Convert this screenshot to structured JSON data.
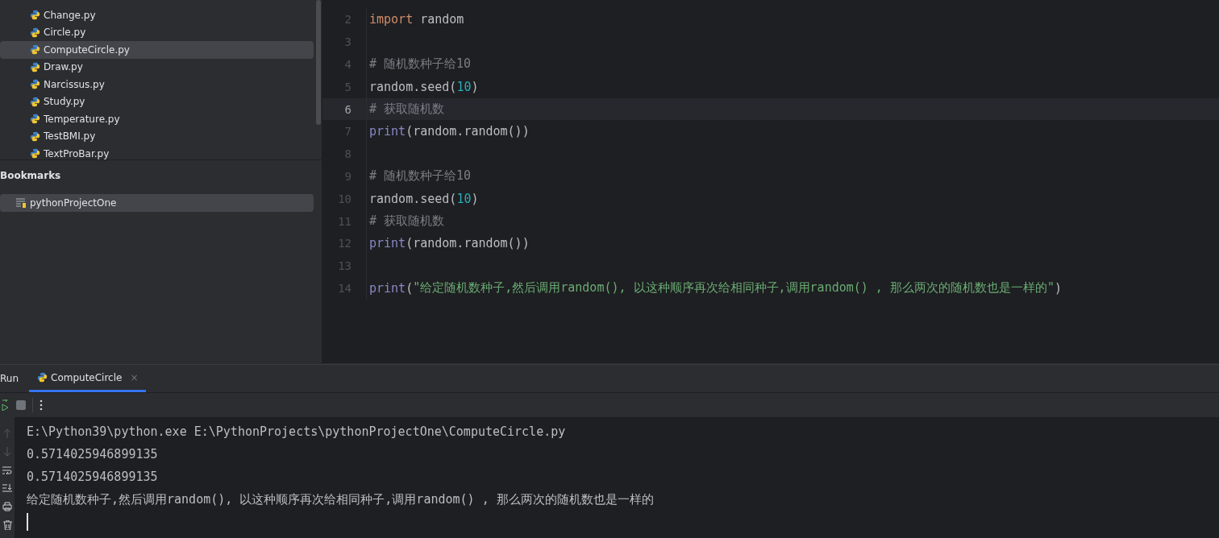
{
  "project_tree": {
    "files": [
      {
        "name": "Change.py",
        "selected": false
      },
      {
        "name": "Circle.py",
        "selected": false
      },
      {
        "name": "ComputeCircle.py",
        "selected": true
      },
      {
        "name": "Draw.py",
        "selected": false
      },
      {
        "name": "Narcissus.py",
        "selected": false
      },
      {
        "name": "Study.py",
        "selected": false
      },
      {
        "name": "Temperature.py",
        "selected": false
      },
      {
        "name": "TestBMI.py",
        "selected": false
      },
      {
        "name": "TextProBar.py",
        "selected": false
      }
    ]
  },
  "bookmarks": {
    "title": "Bookmarks",
    "items": [
      {
        "name": "pythonProjectOne",
        "selected": true
      }
    ]
  },
  "editor": {
    "lines": [
      {
        "number": "2",
        "current": false,
        "tokens": [
          {
            "kind": "keyword",
            "text": "import"
          },
          {
            "kind": "plain",
            "text": " random"
          }
        ]
      },
      {
        "number": "3",
        "current": false
      },
      {
        "number": "4",
        "current": false,
        "tokens": [
          {
            "kind": "comment",
            "text": "# 随机数种子给10"
          }
        ]
      },
      {
        "number": "5",
        "current": false,
        "tokens": [
          {
            "kind": "plain",
            "text": "random.seed("
          },
          {
            "kind": "number",
            "text": "10"
          },
          {
            "kind": "plain",
            "text": ")"
          }
        ]
      },
      {
        "number": "6",
        "current": true,
        "tokens": [
          {
            "kind": "comment",
            "text": "# 获取随机数"
          }
        ]
      },
      {
        "number": "7",
        "current": false,
        "tokens": [
          {
            "kind": "builtin",
            "text": "print"
          },
          {
            "kind": "plain",
            "text": "(random.random())"
          }
        ]
      },
      {
        "number": "8",
        "current": false
      },
      {
        "number": "9",
        "current": false,
        "tokens": [
          {
            "kind": "comment",
            "text": "# 随机数种子给10"
          }
        ]
      },
      {
        "number": "10",
        "current": false,
        "tokens": [
          {
            "kind": "plain",
            "text": "random.seed("
          },
          {
            "kind": "number",
            "text": "10"
          },
          {
            "kind": "plain",
            "text": ")"
          }
        ]
      },
      {
        "number": "11",
        "current": false,
        "tokens": [
          {
            "kind": "comment",
            "text": "# 获取随机数"
          }
        ]
      },
      {
        "number": "12",
        "current": false,
        "tokens": [
          {
            "kind": "builtin",
            "text": "print"
          },
          {
            "kind": "plain",
            "text": "(random.random())"
          }
        ]
      },
      {
        "number": "13",
        "current": false
      },
      {
        "number": "14",
        "current": false,
        "tokens": [
          {
            "kind": "builtin",
            "text": "print"
          },
          {
            "kind": "plain",
            "text": "("
          },
          {
            "kind": "string",
            "text": "\"给定随机数种子,然后调用random(), 以这种顺序再次给相同种子,调用random() , 那么两次的随机数也是一样的\""
          },
          {
            "kind": "plain",
            "text": ")"
          }
        ]
      }
    ]
  },
  "run_panel": {
    "title": "Run",
    "tabs": [
      {
        "label": "ComputeCircle",
        "selected": true,
        "close": "×"
      }
    ],
    "console": {
      "lines": [
        "E:\\Python39\\python.exe E:\\PythonProjects\\pythonProjectOne\\ComputeCircle.py",
        "0.5714025946899135",
        "0.5714025946899135",
        "给定随机数种子,然后调用random(), 以这种顺序再次给相同种子,调用random() , 那么两次的随机数也是一样的"
      ],
      "caret": true
    }
  }
}
